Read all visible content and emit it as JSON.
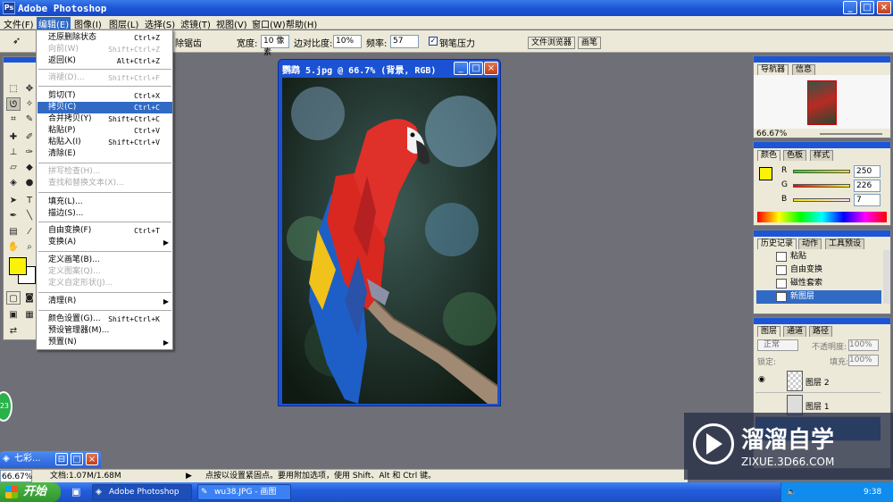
{
  "app": {
    "title": "Adobe Photoshop"
  },
  "menubar": [
    "文件(F)",
    "编辑(E)",
    "图像(I)",
    "图层(L)",
    "选择(S)",
    "滤镜(T)",
    "视图(V)",
    "窗口(W)",
    "帮助(H)"
  ],
  "options": {
    "eliminate_label": "除锯齿",
    "width_label": "宽度:",
    "width_value": "10 像素",
    "contrast_label": "边对比度:",
    "contrast_value": "10%",
    "freq_label": "频率:",
    "freq_value": "57",
    "pen_label": "钢笔压力",
    "tab_browser": "文件浏览器",
    "tab_brush": "画笔"
  },
  "edit_menu": {
    "items": [
      {
        "label": "还原删除状态",
        "shortcut": "Ctrl+Z"
      },
      {
        "label": "向前(W)",
        "shortcut": "Shift+Ctrl+Z",
        "disabled": true
      },
      {
        "label": "返回(K)",
        "shortcut": "Alt+Ctrl+Z"
      },
      {
        "label": "消褪(D)...",
        "shortcut": "Shift+Ctrl+F",
        "disabled": true
      },
      {
        "label": "剪切(T)",
        "shortcut": "Ctrl+X"
      },
      {
        "label": "拷贝(C)",
        "shortcut": "Ctrl+C",
        "selected": true
      },
      {
        "label": "合并拷贝(Y)",
        "shortcut": "Shift+Ctrl+C"
      },
      {
        "label": "粘贴(P)",
        "shortcut": "Ctrl+V"
      },
      {
        "label": "粘贴入(I)",
        "shortcut": "Shift+Ctrl+V"
      },
      {
        "label": "清除(E)",
        "shortcut": ""
      },
      {
        "label": "拼写检查(H)...",
        "shortcut": "",
        "disabled": true
      },
      {
        "label": "查找和替换文本(X)...",
        "shortcut": "",
        "disabled": true
      },
      {
        "label": "填充(L)...",
        "shortcut": ""
      },
      {
        "label": "描边(S)...",
        "shortcut": ""
      },
      {
        "label": "自由变换(F)",
        "shortcut": "Ctrl+T"
      },
      {
        "label": "变换(A)",
        "shortcut": "",
        "submenu": true
      },
      {
        "label": "定义画笔(B)...",
        "shortcut": ""
      },
      {
        "label": "定义图案(Q)...",
        "shortcut": "",
        "disabled": true
      },
      {
        "label": "定义自定形状(J)...",
        "shortcut": "",
        "disabled": true
      },
      {
        "label": "清理(R)",
        "shortcut": "",
        "submenu": true
      },
      {
        "label": "颜色设置(G)...",
        "shortcut": "Shift+Ctrl+K"
      },
      {
        "label": "预设管理器(M)...",
        "shortcut": ""
      },
      {
        "label": "预置(N)",
        "shortcut": "",
        "submenu": true
      }
    ]
  },
  "document": {
    "title": "鹦鹉 5.jpg @ 66.7% (背景, RGB)"
  },
  "navigator": {
    "tabs": [
      "导航器",
      "信息"
    ],
    "zoom": "66.67%"
  },
  "color_panel": {
    "tabs": [
      "颜色",
      "色板",
      "样式"
    ],
    "r_label": "R",
    "g_label": "G",
    "b_label": "B",
    "r": "250",
    "g": "226",
    "b": "7"
  },
  "history_panel": {
    "tabs": [
      "历史记录",
      "动作",
      "工具预设"
    ],
    "items": [
      "粘贴",
      "自由变换",
      "磁性套索",
      "新图层"
    ]
  },
  "layers_panel": {
    "tabs": [
      "图层",
      "通道",
      "路径"
    ],
    "blend_mode": "正常",
    "opacity_label": "不透明度:",
    "opacity": "100%",
    "lock_label": "锁定:",
    "fill_label": "填充:",
    "fill": "100%",
    "layers": [
      "图层 2",
      "图层 1"
    ]
  },
  "status_bar": {
    "zoom": "66.67%",
    "doc": "文档:1.07M/1.68M",
    "hint": "点按以设置紧固点。要用附加选项，使用 Shift、Alt 和 Ctrl 键。"
  },
  "mini_window": {
    "title": "七彩..."
  },
  "green_badge": "23",
  "taskbar": {
    "start": "开始",
    "tasks": [
      "Adobe Photoshop",
      "wu38.JPG - 画图"
    ],
    "time": "9:38"
  },
  "watermark": {
    "title": "溜溜自学",
    "url": "ZIXUE.3D66.COM"
  },
  "colors": {
    "xp_blue": "#1c56d6",
    "menu_highlight": "#316ac5",
    "foreground": "#faf207"
  }
}
